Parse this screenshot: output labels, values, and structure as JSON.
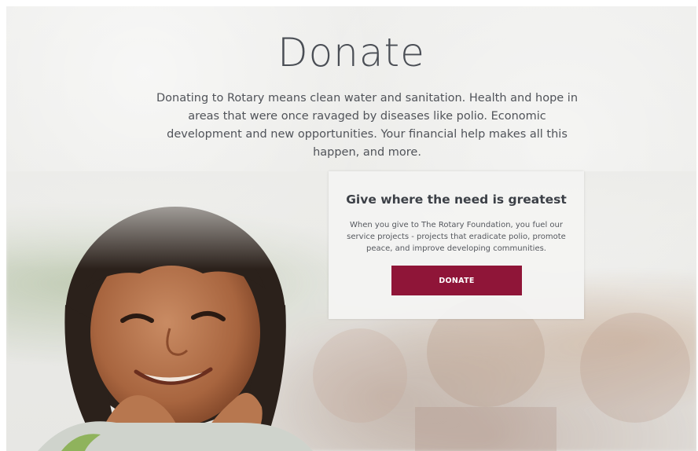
{
  "page": {
    "title": "Donate",
    "intro": "Donating to Rotary means clean water and sanitation. Health and hope in areas that were once ravaged by diseases like polio. Economic development and new opportunities. Your financial help makes all this happen, and more."
  },
  "card": {
    "heading": "Give where the need is greatest",
    "body": "When you give to The Rotary Foundation, you fuel our service projects - projects that eradicate polio, promote peace, and improve developing communities.",
    "button_label": "DONATE"
  },
  "colors": {
    "accent": "#8f1538",
    "text": "#4a4e55",
    "background": "#ebebe8"
  }
}
